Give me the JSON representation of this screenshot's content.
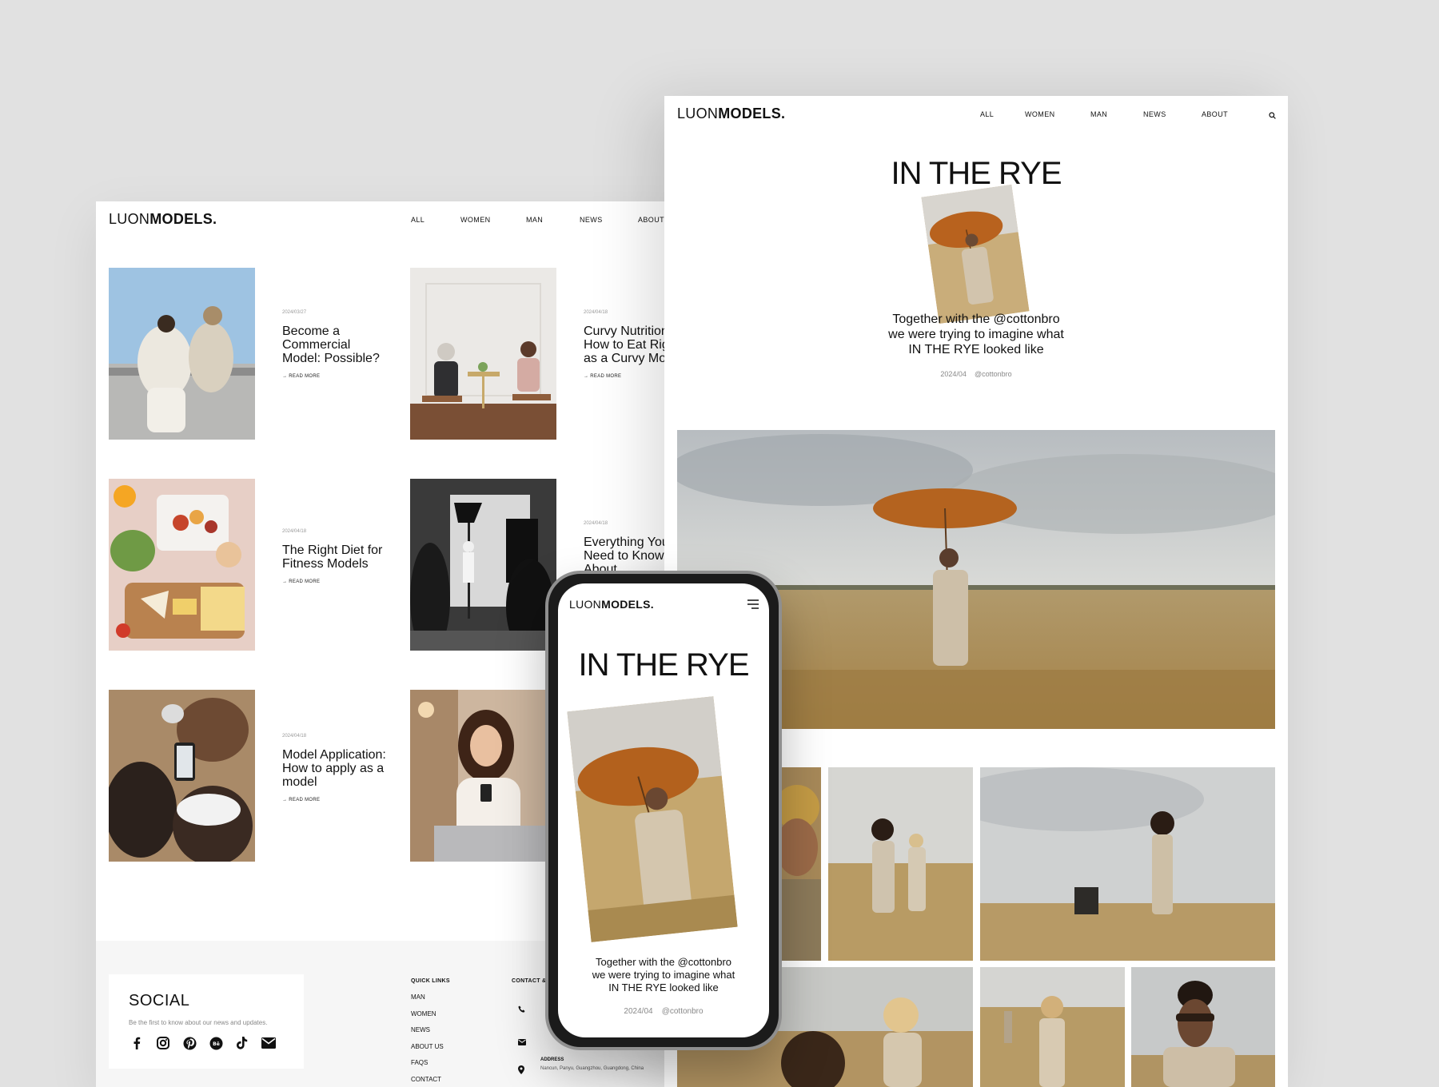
{
  "brand": {
    "light": "LUON",
    "bold": "MODELS."
  },
  "nav": [
    "ALL",
    "WOMEN",
    "MAN",
    "NEWS",
    "ABOUT"
  ],
  "articles": [
    {
      "date": "2024/03/27",
      "title": "Become a Commercial Model: Possible?",
      "read": "→ READ MORE"
    },
    {
      "date": "2024/04/18",
      "title": "Curvy Nutrition: How to Eat Right as a Curvy Model",
      "read": "→ READ MORE"
    },
    {
      "date": "2024/04/18",
      "title": "The Right Diet for Fitness Models",
      "read": "→ READ MORE"
    },
    {
      "date": "2024/04/18",
      "title": "Everything You Need to Know About Commercial",
      "read": ""
    },
    {
      "date": "2024/04/18",
      "title": "Model Application: How to apply as a model",
      "read": "→ READ MORE"
    }
  ],
  "footer": {
    "social_title": "SOCIAL",
    "social_sub": "Be the first to know about our news and updates.",
    "quick_links_title": "QUICK LINKS",
    "quick_links": [
      "MAN",
      "WOMEN",
      "NEWS",
      "ABOUT US",
      "FAQS",
      "CONTACT"
    ],
    "contact_title": "CONTACT &",
    "address_label": "ADDRESS",
    "address": "Nancun, Panyu, Guangzhou, Guangdong, China"
  },
  "story": {
    "title": "IN THE RYE",
    "caption_line1": "Together with the @cottonbro",
    "caption_line2": "we were trying to imagine what",
    "caption_line3": "IN THE RYE looked like",
    "date": "2024/04",
    "handle": "@cottonbro"
  },
  "icons": {
    "social": [
      "facebook-icon",
      "instagram-icon",
      "pinterest-icon",
      "behance-icon",
      "tiktok-icon",
      "mail-icon"
    ],
    "contact": [
      "phone-icon",
      "mail-icon",
      "location-icon"
    ]
  }
}
